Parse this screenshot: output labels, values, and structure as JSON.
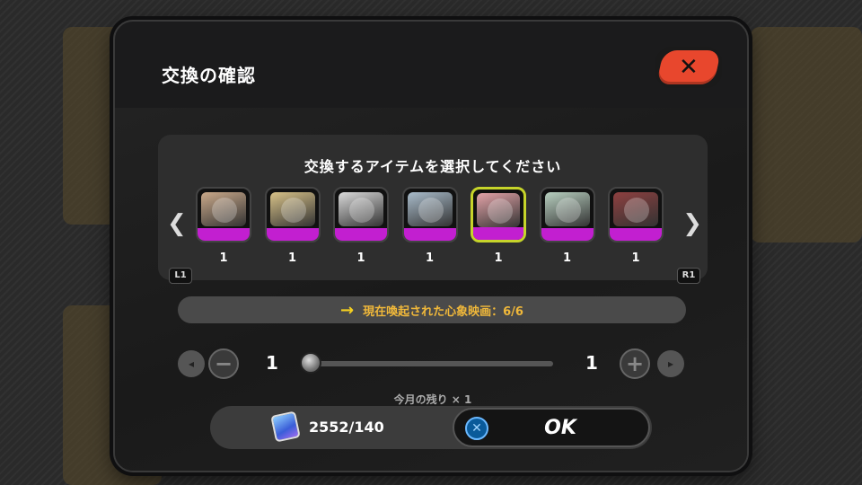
{
  "dialog": {
    "title": "交換の確認",
    "close_icon": "close-x-icon",
    "close_glyph": "✕"
  },
  "selection": {
    "prompt": "交換するアイテムを選択してください",
    "prev_arrow": "❮",
    "next_arrow": "❯",
    "left_shoulder": "L1",
    "right_shoulder": "R1",
    "items": [
      {
        "count": "1",
        "color": "#caa98a",
        "selected": false
      },
      {
        "count": "1",
        "color": "#d8c288",
        "selected": false
      },
      {
        "count": "1",
        "color": "#d9d9d9",
        "selected": false
      },
      {
        "count": "1",
        "color": "#a9bccb",
        "selected": false
      },
      {
        "count": "1",
        "color": "#e4a3a8",
        "selected": true
      },
      {
        "count": "1",
        "color": "#b8d0c0",
        "selected": false
      },
      {
        "count": "1",
        "color": "#8e4040",
        "selected": false
      }
    ]
  },
  "info": {
    "text": "現在喚起された心象映画：6/6",
    "arrow": "→"
  },
  "quantity": {
    "minus_glyph": "−",
    "plus_glyph": "+",
    "min_value": "1",
    "max_value": "1",
    "slider_fraction": 0,
    "remaining_text": "今月の残り × 1"
  },
  "footer": {
    "currency_amount": "2552/140",
    "cross_glyph": "✕",
    "ok_label": "OK"
  },
  "colors": {
    "accent_close": "#e8472d",
    "item_bar": "#c21fd0",
    "selected_border": "#c6d42a",
    "info_text": "#f0b83a"
  }
}
